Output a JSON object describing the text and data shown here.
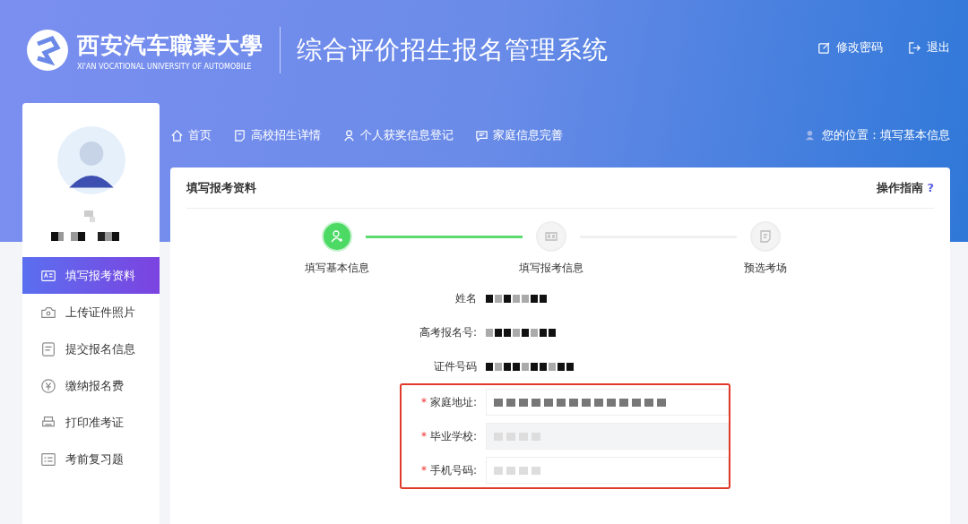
{
  "header": {
    "logo_cn": "西安汽车職業大學",
    "logo_en": "XI'AN VOCATIONAL UNIVERSITY OF AUTOMOBILE",
    "system_title": "综合评价招生报名管理系统",
    "actions": [
      {
        "label": "修改密码"
      },
      {
        "label": "退出"
      }
    ]
  },
  "sidebar": {
    "items": [
      {
        "label": "填写报考资料",
        "selected": true
      },
      {
        "label": "上传证件照片",
        "selected": false
      },
      {
        "label": "提交报名信息",
        "selected": false
      },
      {
        "label": "缴纳报名费",
        "selected": false
      },
      {
        "label": "打印准考证",
        "selected": false
      },
      {
        "label": "考前复习题",
        "selected": false
      }
    ]
  },
  "nav": {
    "links": [
      {
        "label": "首页"
      },
      {
        "label": "高校招生详情"
      },
      {
        "label": "个人获奖信息登记"
      },
      {
        "label": "家庭信息完善"
      }
    ],
    "location": "您的位置：填写基本信息"
  },
  "panel": {
    "title": "填写报考资料",
    "help": "操作指南",
    "help_mark": "?"
  },
  "steps": [
    {
      "label": "填写基本信息",
      "completed": true
    },
    {
      "label": "填写报考信息",
      "completed": false
    },
    {
      "label": "预选考场",
      "completed": false
    }
  ],
  "info_rows": [
    {
      "label": "姓名"
    },
    {
      "label": "高考报名号:"
    },
    {
      "label": "证件号码"
    }
  ],
  "fields": [
    {
      "label": "家庭地址:",
      "required": true,
      "mark": "*"
    },
    {
      "label": "毕业学校:",
      "required": true,
      "mark": "*"
    },
    {
      "label": "手机号码:",
      "required": true,
      "mark": "*"
    }
  ]
}
